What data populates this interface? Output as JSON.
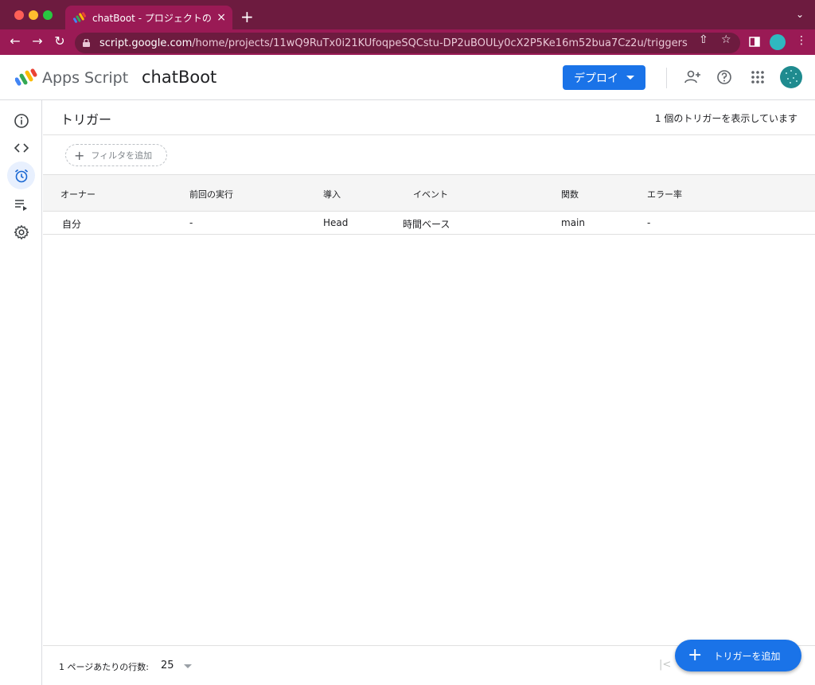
{
  "browser": {
    "tab_title": "chatBoot - プロジェクトのトリガー",
    "tab_close": "×",
    "new_tab": "+",
    "url_host": "script.google.com",
    "url_path": "/home/projects/11wQ9RuTx0i21KUfoqpeSQCstu-DP2uBOULy0cX2P5Ke16m52bua7Cz2u/triggers"
  },
  "header": {
    "product_name": "Apps Script",
    "project_name": "chatBoot",
    "deploy_label": "デプロイ"
  },
  "main": {
    "title": "トリガー",
    "count_text": "1 個のトリガーを表示しています",
    "filter_label": "フィルタを追加",
    "columns": [
      "オーナー",
      "前回の実行",
      "導入",
      "イベント",
      "関数",
      "エラー率"
    ],
    "rows": [
      [
        "自分",
        "-",
        "Head",
        "時間ベース",
        "main",
        "-"
      ]
    ],
    "rows_per_page_label": "1 ページあたりの行数:",
    "rows_per_page_value": "25",
    "add_trigger_label": "トリガーを追加"
  },
  "colors": {
    "chrome_dark": "#6d1b3f",
    "chrome_toolbar": "#9a1a55",
    "accent": "#1a73e8",
    "sidebar_active_bg": "#e8f0fe"
  }
}
